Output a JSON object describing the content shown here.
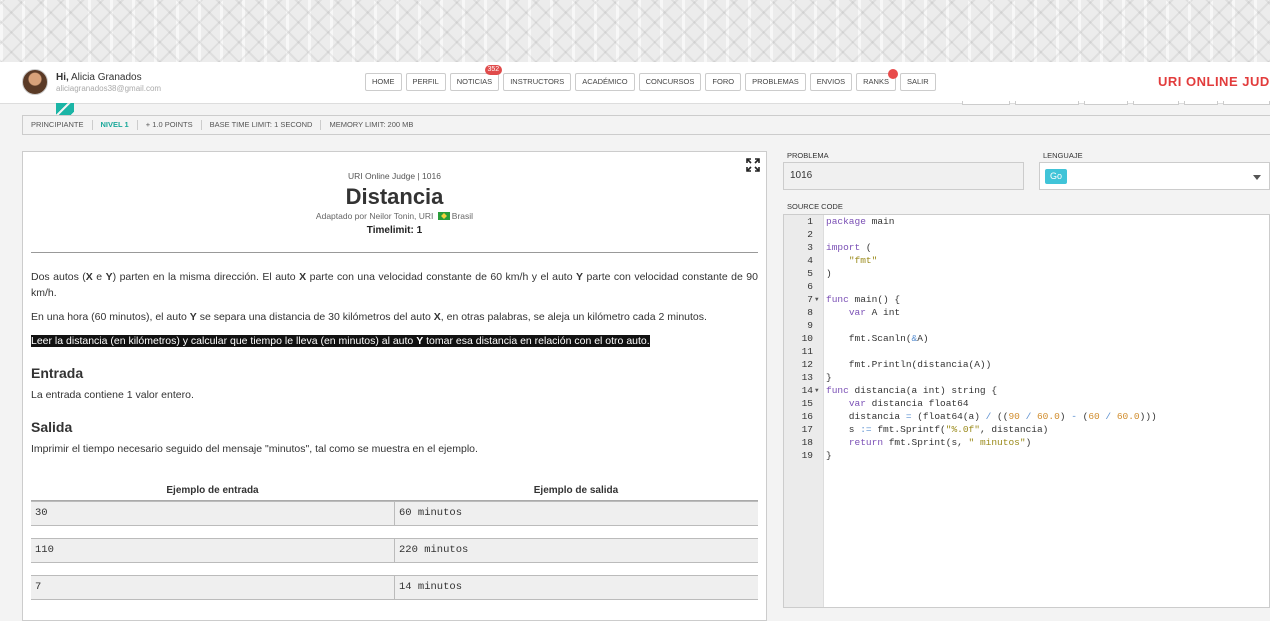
{
  "user": {
    "greeting_prefix": "Hi,",
    "name": "Alicia Granados",
    "email": "aliciagranados38@gmail.com"
  },
  "nav": [
    {
      "label": "HOME"
    },
    {
      "label": "PERFIL"
    },
    {
      "label": "NOTICIAS",
      "badge": "352"
    },
    {
      "label": "INSTRUCTORS"
    },
    {
      "label": "ACADÉMICO"
    },
    {
      "label": "CONCURSOS"
    },
    {
      "label": "FORO"
    },
    {
      "label": "PROBLEMAS"
    },
    {
      "label": "ENVIOS"
    },
    {
      "label": "RANKS",
      "dot": true
    },
    {
      "label": "SALIR"
    }
  ],
  "brand": "URI ONLINE JUDG",
  "breadcrumb": [
    "PRINCIPIANTE",
    "NIVEL 1",
    "+ 1.0 POINTS",
    "BASE TIME LIMIT: 1 SECOND",
    "MEMORY LIMIT: 200 MB"
  ],
  "problem": {
    "judge_line": "URI Online Judge | 1016",
    "title": "Distancia",
    "author_prefix": "Adaptado por Neilor Tonin, URI",
    "author_country": "Brasil",
    "timelimit": "Timelimit: 1",
    "paragraph1": "Dos autos (X e Y) parten en la misma dirección. El auto X parte con una velocidad constante de 60 km/h y el auto Y parte con velocidad constante de 90 km/h.",
    "paragraph2": "En una hora (60 minutos), el auto Y se separa una distancia de 30 kilómetros del auto X, en otras palabras, se aleja un kilómetro cada 2 minutos.",
    "paragraph3": "Leer la distancia (en kilómetros) y calcular que tiempo le lleva (en minutos) al auto Y tomar esa distancia en relación con el otro auto.",
    "input_heading": "Entrada",
    "input_text": "La entrada contiene 1 valor entero.",
    "output_heading": "Salida",
    "output_text": "Imprimir el tiempo necesario seguido del mensaje \"minutos\", tal como se muestra en el ejemplo.",
    "samples_header": [
      "Ejemplo de entrada",
      "Ejemplo de salida"
    ],
    "samples": [
      {
        "input": "30",
        "output": "60 minutos"
      },
      {
        "input": "110",
        "output": "220 minutos"
      },
      {
        "input": "7",
        "output": "14 minutos"
      }
    ]
  },
  "submit": {
    "problem_label": "PROBLEMA",
    "problem_value": "1016",
    "language_label": "LENGUAJE",
    "language_value": "Go",
    "source_label": "SOURCE CODE"
  },
  "code_lines": [
    "package main",
    "",
    "import (",
    "    \"fmt\"",
    ")",
    "",
    "func main() {",
    "    var A int",
    "",
    "    fmt.Scanln(&A)",
    "",
    "    fmt.Println(distancia(A))",
    "}",
    "func distancia(a int) string {",
    "    var distancia float64",
    "    distancia = (float64(a) / ((90 / 60.0) - (60 / 60.0)))",
    "    s := fmt.Sprintf(\"%.0f\", distancia)",
    "    return fmt.Sprint(s, \" minutos\")",
    "}"
  ]
}
